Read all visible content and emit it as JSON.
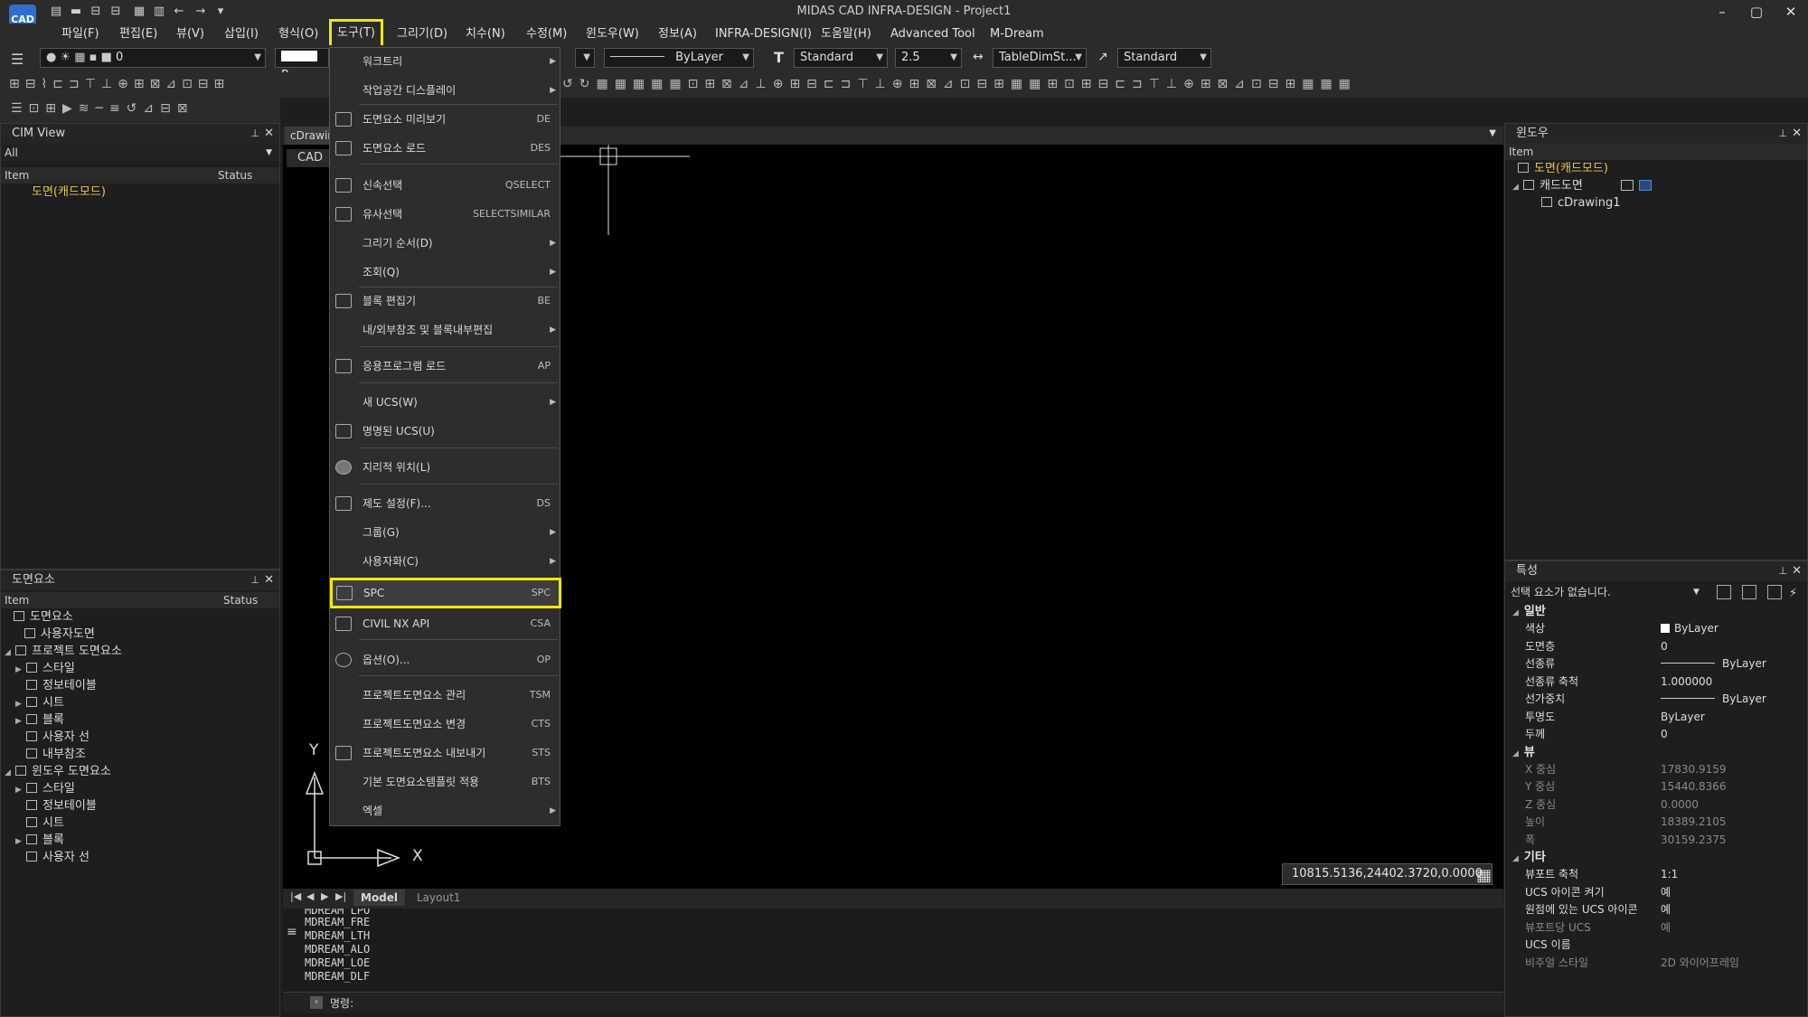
{
  "app": {
    "logo": "CAD",
    "title": "MIDAS CAD INFRA-DESIGN - Project1",
    "win_buttons": [
      "–",
      "▢",
      "✕"
    ]
  },
  "menubar": {
    "items": [
      "파일(F)",
      "편집(E)",
      "뷰(V)",
      "삽입(I)",
      "형식(O)",
      "도구(T)",
      "그리기(D)",
      "치수(N)",
      "수정(M)",
      "윈도우(W)",
      "정보(A)",
      "INFRA-DESIGN(I)",
      "도움말(H)",
      "Advanced Tool",
      "M-Dream"
    ]
  },
  "toolbar": {
    "layer_value": "0",
    "color_value": "B",
    "linetype": "ByLayer",
    "text_style": "Standard",
    "text_height": "2.5",
    "dim_style": "TableDimSt...",
    "ml_style": "Standard"
  },
  "cim_view": {
    "title": "CIM View",
    "filter": "All",
    "col_item": "Item",
    "col_status": "Status",
    "items": [
      "도면(캐드모드)"
    ]
  },
  "drawing_elements": {
    "title": "도면요소",
    "col_item": "Item",
    "col_status": "Status",
    "items": [
      "도면요소",
      "사용자도면",
      "프로젝트 도면요소",
      "스타일",
      "정보테이블",
      "시트",
      "블록",
      "사용자 선",
      "내부참조",
      "윈도우 도면요소",
      "스타일",
      "정보테이블",
      "시트",
      "블록",
      "사용자 선"
    ]
  },
  "doc": {
    "tab": "cDrawin",
    "subtab": "CAD",
    "layout_tabs": [
      "Model",
      "Layout1"
    ],
    "coords": "10815.5136,24402.3720,0.0000",
    "ucs_x": "X",
    "ucs_y": "Y"
  },
  "context_menu": {
    "items": [
      {
        "label": "워크트리",
        "shortcut": "",
        "submenu": true
      },
      {
        "label": "작업공간 디스플레이",
        "shortcut": "",
        "submenu": true
      },
      {
        "label": "도면요소 미리보기",
        "shortcut": "DE",
        "submenu": false
      },
      {
        "label": "도면요소 로드",
        "shortcut": "DES",
        "submenu": false
      },
      {
        "label": "신속선택",
        "shortcut": "QSELECT",
        "submenu": false
      },
      {
        "label": "유사선택",
        "shortcut": "SELECTSIMILAR",
        "submenu": false
      },
      {
        "label": "그리기 순서(D)",
        "shortcut": "",
        "submenu": true
      },
      {
        "label": "조회(Q)",
        "shortcut": "",
        "submenu": true
      },
      {
        "label": "블록 편집기",
        "shortcut": "BE",
        "submenu": false
      },
      {
        "label": "내/외부참조 및 블록내부편집",
        "shortcut": "",
        "submenu": true
      },
      {
        "label": "응용프로그램 로드",
        "shortcut": "AP",
        "submenu": false
      },
      {
        "label": "새 UCS(W)",
        "shortcut": "",
        "submenu": true
      },
      {
        "label": "명명된 UCS(U)",
        "shortcut": "",
        "submenu": false
      },
      {
        "label": "지리적 위치(L)",
        "shortcut": "",
        "submenu": false
      },
      {
        "label": "제도 설정(F)...",
        "shortcut": "DS",
        "submenu": false
      },
      {
        "label": "그룹(G)",
        "shortcut": "",
        "submenu": true
      },
      {
        "label": "사용자화(C)",
        "shortcut": "",
        "submenu": true
      },
      {
        "label": "SPC",
        "shortcut": "SPC",
        "submenu": false
      },
      {
        "label": "CIVIL NX API",
        "shortcut": "CSA",
        "submenu": false
      },
      {
        "label": "옵션(O)...",
        "shortcut": "OP",
        "submenu": false
      },
      {
        "label": "프로젝트도면요소 관리",
        "shortcut": "TSM",
        "submenu": false
      },
      {
        "label": "프로젝트도면요소 변경",
        "shortcut": "CTS",
        "submenu": false
      },
      {
        "label": "프로젝트도면요소 내보내기",
        "shortcut": "STS",
        "submenu": false
      },
      {
        "label": "기본 도면요소템플릿 적용",
        "shortcut": "BTS",
        "submenu": false
      },
      {
        "label": "엑셀",
        "shortcut": "",
        "submenu": true
      }
    ]
  },
  "command": {
    "lines": [
      "MDREAM_LPO",
      "MDREAM_FRE",
      "MDREAM_LTH",
      "MDREAM_ALO",
      "MDREAM_LOE",
      "MDREAM_DLF"
    ],
    "prompt": "명령:"
  },
  "window_panel": {
    "title": "윈도우",
    "col_item": "Item",
    "items": [
      "도면(캐드모드)",
      "캐드도면",
      "cDrawing1"
    ]
  },
  "properties": {
    "title": "특성",
    "selection": "선택 요소가 없습니다.",
    "groups": [
      {
        "name": "일반",
        "rows": [
          [
            "색상",
            "ByLayer"
          ],
          [
            "도면층",
            "0"
          ],
          [
            "선종류",
            "ByLayer"
          ],
          [
            "선종류 축척",
            "1.000000"
          ],
          [
            "선가중치",
            "ByLayer"
          ],
          [
            "투명도",
            "ByLayer"
          ],
          [
            "두께",
            "0"
          ]
        ]
      },
      {
        "name": "뷰",
        "rows": [
          [
            "X 중심",
            "17830.9159"
          ],
          [
            "Y 중심",
            "15440.8366"
          ],
          [
            "Z 중심",
            "0.0000"
          ],
          [
            "높이",
            "18389.2105"
          ],
          [
            "폭",
            "30159.2375"
          ]
        ]
      },
      {
        "name": "기타",
        "rows": [
          [
            "뷰포트 축척",
            "1:1"
          ],
          [
            "UCS 아이콘 켜기",
            "예"
          ],
          [
            "원점에 있는 UCS 아이콘",
            "예"
          ],
          [
            "뷰포트당 UCS",
            "예"
          ],
          [
            "UCS 이름",
            ""
          ],
          [
            "비주얼 스타일",
            "2D 와이어프레임"
          ]
        ]
      }
    ]
  },
  "colors": {
    "highlight": "#f5e800",
    "bg": "#1e1e1e",
    "canvas": "#000000"
  }
}
